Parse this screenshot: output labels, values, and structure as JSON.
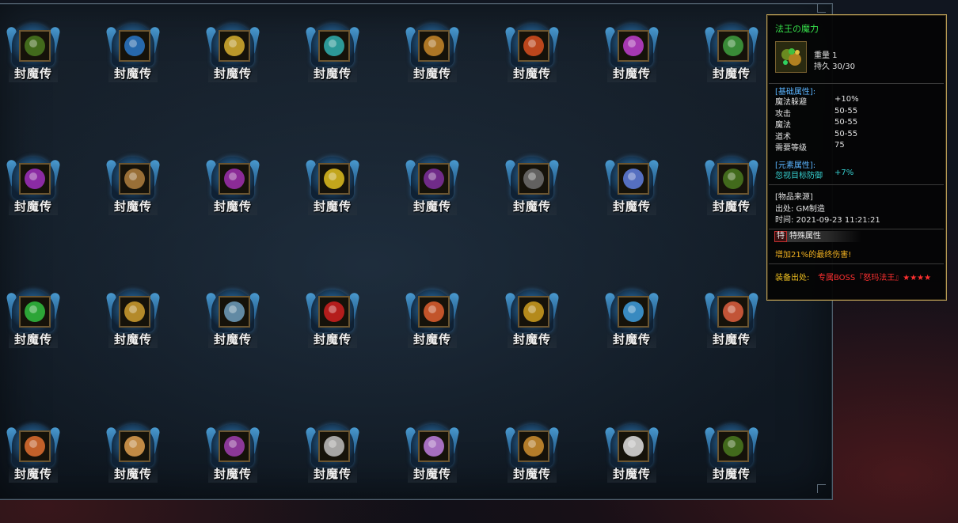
{
  "slot_label": "封魔传",
  "inventory": {
    "rows": [
      [
        {
          "icon": "green-gem-cluster-icon",
          "tone": "#4a7a20"
        },
        {
          "icon": "blue-flame-orb-icon",
          "tone": "#2a78c8"
        },
        {
          "icon": "golden-scooter-icon",
          "tone": "#d8b030"
        },
        {
          "icon": "teal-orb-icon",
          "tone": "#30b0b0"
        },
        {
          "icon": "treasure-chest-icon",
          "tone": "#c8882a"
        },
        {
          "icon": "flame-armor-icon",
          "tone": "#d85020"
        },
        {
          "icon": "purple-winged-figure-icon",
          "tone": "#c040d0"
        },
        {
          "icon": "green-potion-bottle-icon",
          "tone": "#40a040"
        }
      ],
      [
        {
          "icon": "purple-ring-icon",
          "tone": "#a030c0"
        },
        {
          "icon": "staff-icon",
          "tone": "#b08040"
        },
        {
          "icon": "purple-gauntlet-icon",
          "tone": "#a030b0"
        },
        {
          "icon": "yellow-rose-icon",
          "tone": "#e0c020"
        },
        {
          "icon": "purple-amulet-icon",
          "tone": "#8030a0"
        },
        {
          "icon": "dark-blade-icon",
          "tone": "#707070"
        },
        {
          "icon": "crystal-gem-icon",
          "tone": "#6080e0"
        },
        {
          "icon": "green-gem-cluster-icon",
          "tone": "#4a7a20"
        }
      ],
      [
        {
          "icon": "green-crystal-icon",
          "tone": "#30c040"
        },
        {
          "icon": "golden-helmet-icon",
          "tone": "#d0a030"
        },
        {
          "icon": "mechanical-crossbow-icon",
          "tone": "#70a0c0"
        },
        {
          "icon": "red-sports-car-icon",
          "tone": "#d02020"
        },
        {
          "icon": "red-fire-orb-icon",
          "tone": "#e06030"
        },
        {
          "icon": "golden-medallion-icon",
          "tone": "#d0a020"
        },
        {
          "icon": "blue-necklace-icon",
          "tone": "#40a0e0"
        },
        {
          "icon": "red-fist-orb-icon",
          "tone": "#e06040"
        }
      ],
      [
        {
          "icon": "fire-sword-icon",
          "tone": "#e07030"
        },
        {
          "icon": "jeweled-crown-icon",
          "tone": "#e0a050"
        },
        {
          "icon": "purple-golden-armor-icon",
          "tone": "#a040b0"
        },
        {
          "icon": "cleaver-knife-icon",
          "tone": "#c0c0c0"
        },
        {
          "icon": "purple-gem-ring-icon",
          "tone": "#c080e0"
        },
        {
          "icon": "golden-feathered-sword-icon",
          "tone": "#d09030"
        },
        {
          "icon": "rocket-icon",
          "tone": "#e0e0e0"
        },
        {
          "icon": "green-gem-cluster-icon",
          "tone": "#4a7a20"
        }
      ]
    ]
  },
  "tooltip": {
    "title": "法王の魔力",
    "icon": "green-gem-cluster-icon",
    "weight": "重量 1",
    "durability": "持久 30/30",
    "base_head": "[基础属性]:",
    "base_stats": [
      {
        "name": "魔法躲避",
        "value": "+10%"
      },
      {
        "name": "攻击",
        "value": "50-55"
      },
      {
        "name": "魔法",
        "value": "50-55"
      },
      {
        "name": "道术",
        "value": "50-55"
      },
      {
        "name": "需要等级",
        "value": "75"
      }
    ],
    "element_head": "[元素属性]:",
    "element_stats": [
      {
        "name": "忽视目标防御",
        "value": "+7%"
      }
    ],
    "source_head": "[物品来源]",
    "source_origin": "出处: GM制造",
    "source_time": "时间: 2021-09-23 11:21:21",
    "special_badge": "特",
    "special_title": "特殊属性",
    "special_text": "增加21%的最终伤害!",
    "drop_label": "装备出处:",
    "drop_value": "专属BOSS『怒玛法王』★★★★",
    "colors": {
      "title": "#36e04a",
      "head": "#5ab4ff",
      "element_text": "#36d0d0",
      "special_text": "#f0b020",
      "drop_label": "#f0c020",
      "drop_value": "#ff3030",
      "border": "#b69b55"
    }
  }
}
